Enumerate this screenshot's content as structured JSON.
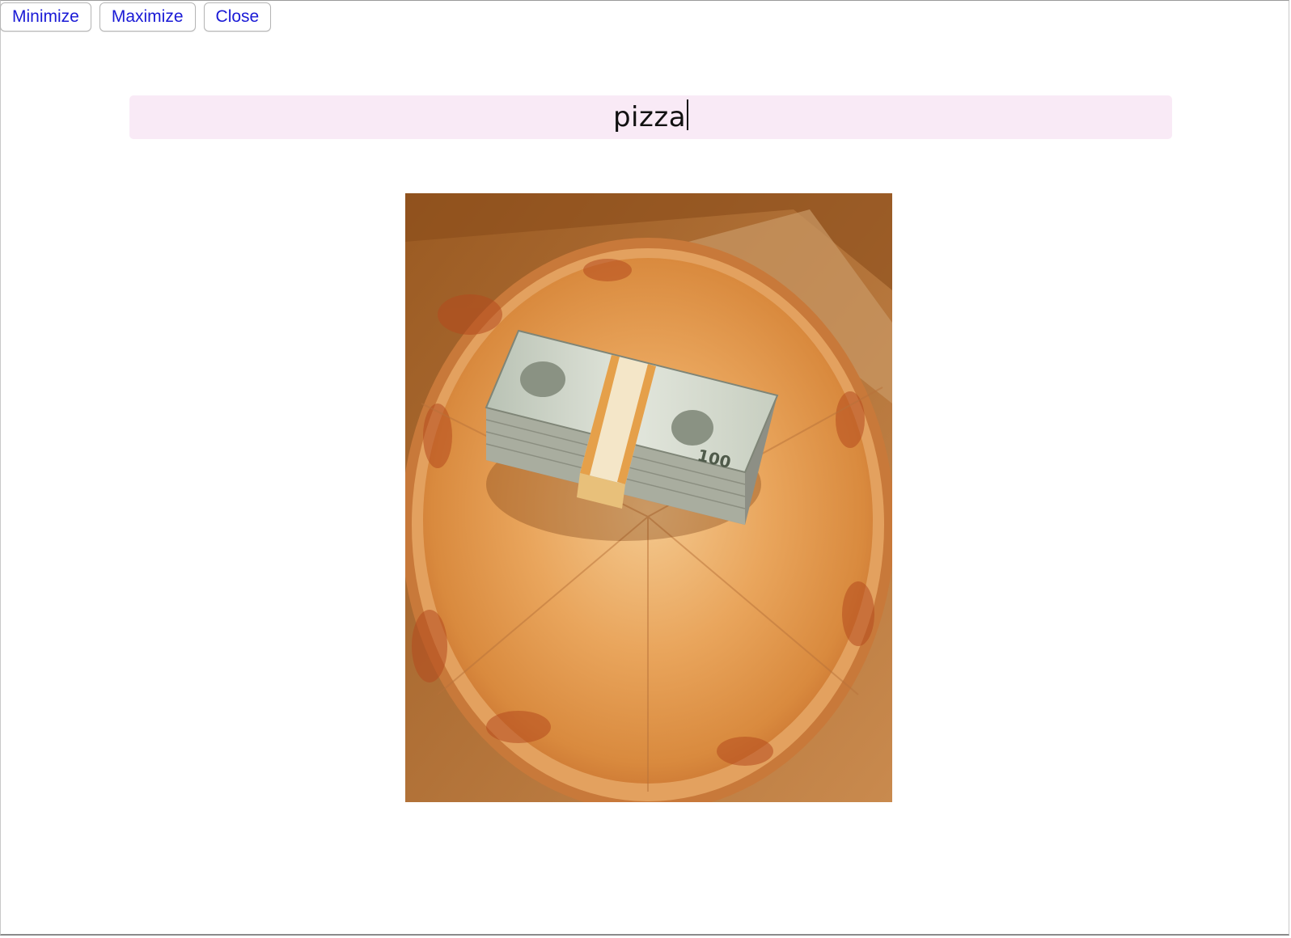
{
  "toolbar": {
    "minimize_label": "Minimize",
    "maximize_label": "Maximize",
    "close_label": "Close"
  },
  "search": {
    "value": "pizza"
  },
  "colors": {
    "button_text": "#1a1ad6",
    "search_bg": "#f9eaf6"
  },
  "image": {
    "subject": "pizza-with-money-stack",
    "banknote_denomination": "100"
  }
}
